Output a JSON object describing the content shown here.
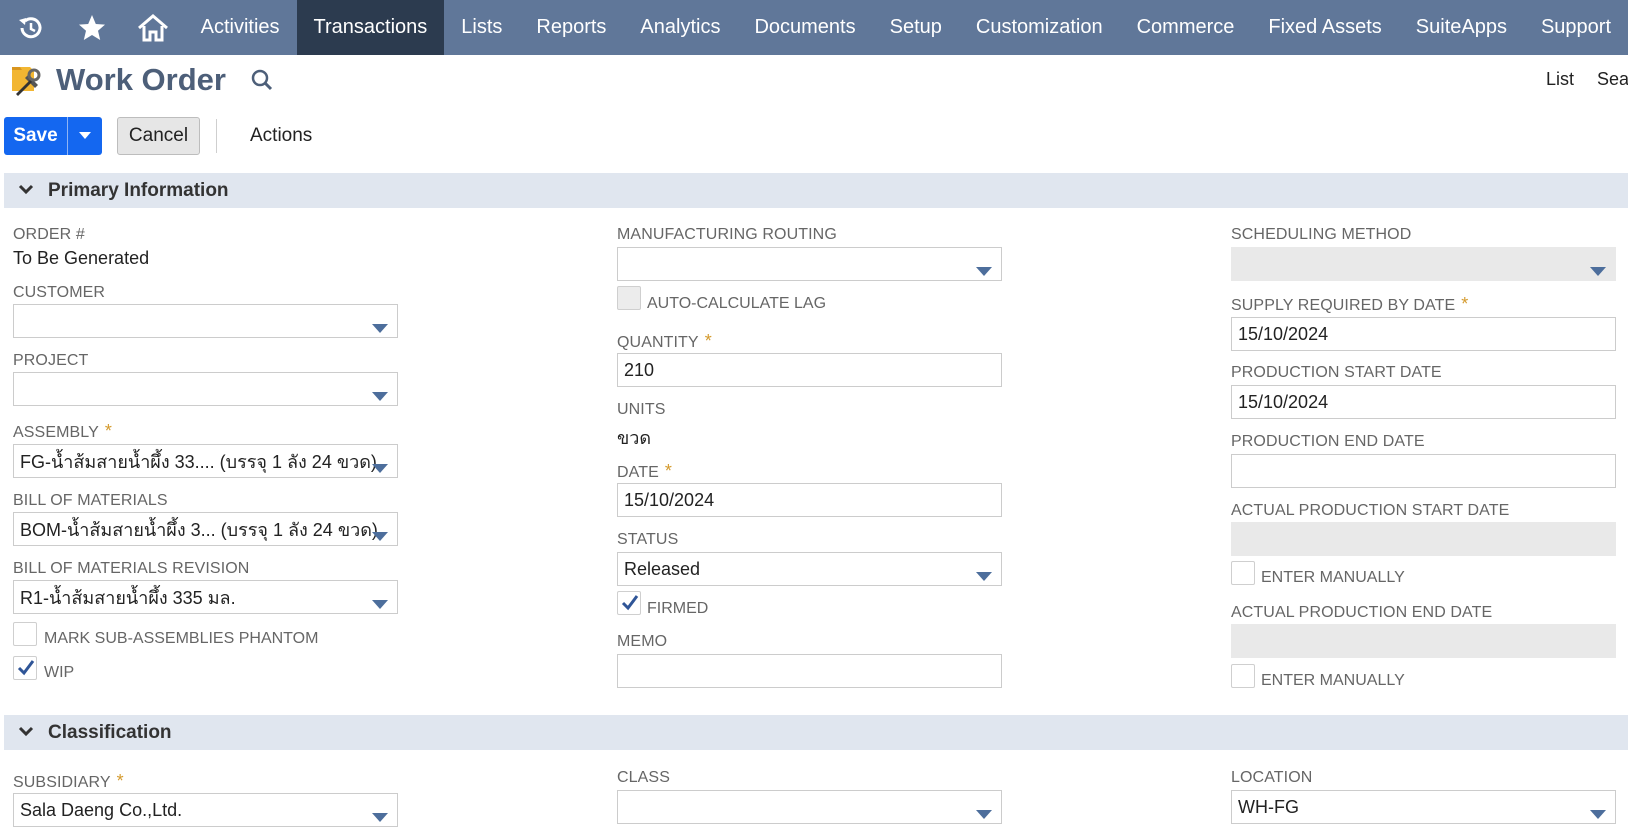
{
  "nav": {
    "items": [
      {
        "label": "Activities",
        "active": false
      },
      {
        "label": "Transactions",
        "active": true
      },
      {
        "label": "Lists",
        "active": false
      },
      {
        "label": "Reports",
        "active": false
      },
      {
        "label": "Analytics",
        "active": false
      },
      {
        "label": "Documents",
        "active": false
      },
      {
        "label": "Setup",
        "active": false
      },
      {
        "label": "Customization",
        "active": false
      },
      {
        "label": "Commerce",
        "active": false
      },
      {
        "label": "Fixed Assets",
        "active": false
      },
      {
        "label": "SuiteApps",
        "active": false
      },
      {
        "label": "Support",
        "active": false
      }
    ],
    "icons": [
      "recent-icon",
      "star-icon",
      "home-icon"
    ]
  },
  "header": {
    "title": "Work Order",
    "links": {
      "list": "List",
      "search": "Search"
    }
  },
  "toolbar": {
    "save_label": "Save",
    "cancel_label": "Cancel",
    "actions_label": "Actions"
  },
  "primary": {
    "section_title": "Primary Information",
    "order_no": {
      "label": "ORDER #",
      "value": "To Be Generated"
    },
    "customer": {
      "label": "CUSTOMER",
      "value": ""
    },
    "project": {
      "label": "PROJECT",
      "value": ""
    },
    "assembly": {
      "label": "ASSEMBLY",
      "value": "FG-น้ำส้มสายน้ำผึ้ง 33.... (บรรจุ 1 ลัง 24 ขวด)"
    },
    "bom": {
      "label": "BILL OF MATERIALS",
      "value": "BOM-น้ำส้มสายน้ำผึ้ง 3... (บรรจุ 1 ลัง 24 ขวด)"
    },
    "bom_revision": {
      "label": "BILL OF MATERIALS REVISION",
      "value": "R1-น้ำส้มสายน้ำผึ้ง 335 มล."
    },
    "mark_phantom": {
      "label": "MARK SUB-ASSEMBLIES PHANTOM",
      "checked": false
    },
    "wip": {
      "label": "WIP",
      "checked": true
    },
    "routing": {
      "label": "MANUFACTURING ROUTING",
      "value": ""
    },
    "auto_lag": {
      "label": "AUTO-CALCULATE LAG",
      "checked": false
    },
    "quantity": {
      "label": "QUANTITY",
      "value": "210"
    },
    "units": {
      "label": "UNITS",
      "value": "ขวด"
    },
    "date": {
      "label": "DATE",
      "value": "15/10/2024"
    },
    "status": {
      "label": "STATUS",
      "value": "Released"
    },
    "firmed": {
      "label": "FIRMED",
      "checked": true
    },
    "memo": {
      "label": "MEMO",
      "value": ""
    },
    "scheduling": {
      "label": "SCHEDULING METHOD",
      "value": ""
    },
    "supply_required": {
      "label": "SUPPLY REQUIRED BY DATE",
      "value": "15/10/2024"
    },
    "prod_start": {
      "label": "PRODUCTION START DATE",
      "value": "15/10/2024"
    },
    "prod_end": {
      "label": "PRODUCTION END DATE",
      "value": ""
    },
    "actual_start": {
      "label": "ACTUAL PRODUCTION START DATE",
      "value": ""
    },
    "enter_manually_1": {
      "label": "ENTER MANUALLY",
      "checked": false
    },
    "actual_end": {
      "label": "ACTUAL PRODUCTION END DATE",
      "value": ""
    },
    "enter_manually_2": {
      "label": "ENTER MANUALLY",
      "checked": false
    },
    "required_mark": "*"
  },
  "classification": {
    "section_title": "Classification",
    "subsidiary": {
      "label": "SUBSIDIARY",
      "value": "Sala Daeng Co.,Ltd."
    },
    "class": {
      "label": "CLASS",
      "value": ""
    },
    "location": {
      "label": "LOCATION",
      "value": "WH-FG"
    }
  },
  "colors": {
    "nav_bg": "#607799",
    "nav_active": "#2c3b4f",
    "save_blue": "#1467f0",
    "section_bg": "#e0e6ef",
    "required": "#d49a2d"
  }
}
